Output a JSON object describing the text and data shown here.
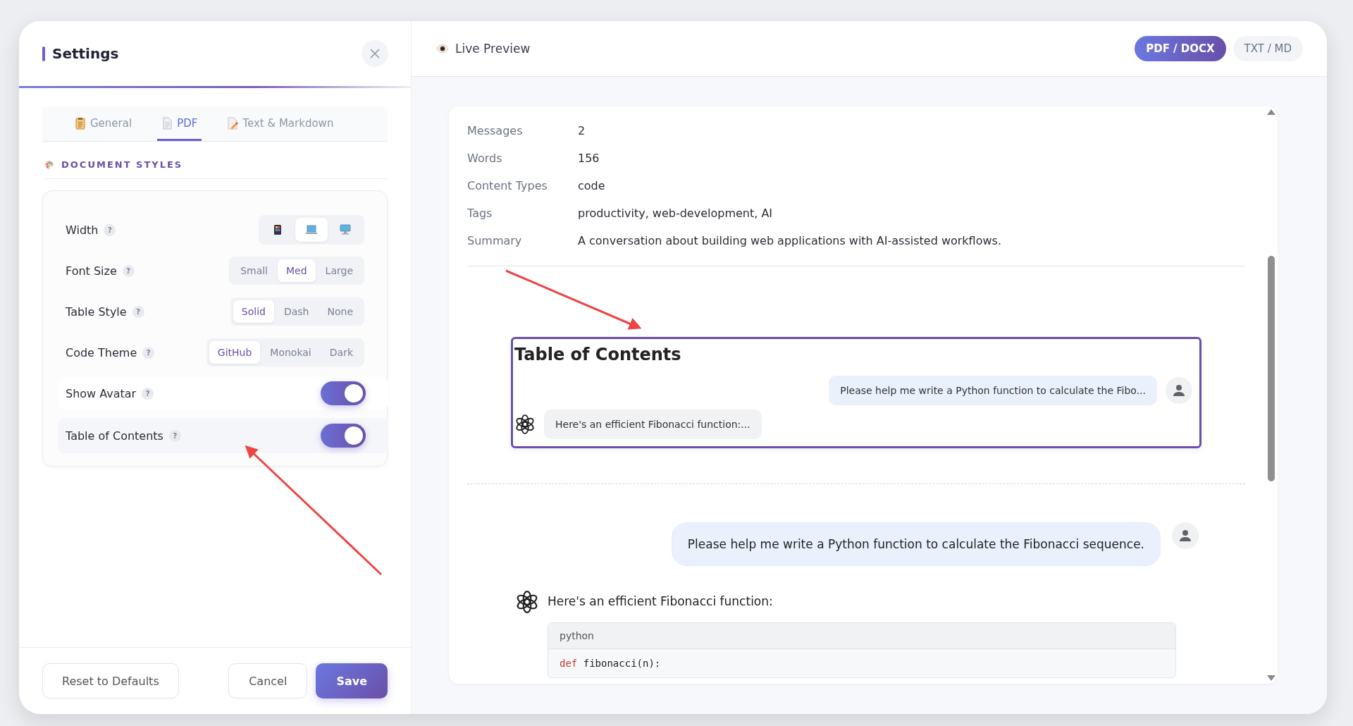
{
  "settings": {
    "title": "Settings",
    "tabs": [
      {
        "label": "General",
        "selected": false
      },
      {
        "label": "PDF",
        "selected": true
      },
      {
        "label": "Text & Markdown",
        "selected": false
      }
    ],
    "section_title": "DOCUMENT STYLES",
    "options": [
      {
        "kind": "icons",
        "label": "Width",
        "help": "?",
        "choices": [
          {
            "selected": false
          },
          {
            "selected": true
          },
          {
            "selected": false
          }
        ]
      },
      {
        "kind": "segmented",
        "label": "Font Size",
        "help": "?",
        "choices": [
          {
            "label": "Small",
            "selected": false
          },
          {
            "label": "Med",
            "selected": true
          },
          {
            "label": "Large",
            "selected": false
          }
        ]
      },
      {
        "kind": "segmented",
        "label": "Table Style",
        "help": "?",
        "choices": [
          {
            "label": "Solid",
            "selected": true
          },
          {
            "label": "Dash",
            "selected": false
          },
          {
            "label": "None",
            "selected": false
          }
        ]
      },
      {
        "kind": "segmented",
        "label": "Code Theme",
        "help": "?",
        "choices": [
          {
            "label": "GitHub",
            "selected": true
          },
          {
            "label": "Monokai",
            "selected": false
          },
          {
            "label": "Dark",
            "selected": false
          }
        ]
      },
      {
        "kind": "toggle",
        "label": "Show Avatar",
        "help": "?",
        "on": true,
        "highlighted": false
      },
      {
        "kind": "toggle",
        "label": "Table of Contents",
        "help": "?",
        "on": true,
        "highlighted": true
      }
    ],
    "buttons": [
      {
        "label": "Reset to Defaults",
        "kind": "secondary"
      },
      {
        "label": "Cancel",
        "kind": "secondary"
      },
      {
        "label": "Save",
        "kind": "primary"
      }
    ]
  },
  "preview": {
    "title": "Live Preview",
    "formats": [
      {
        "label": "PDF / DOCX",
        "selected": true
      },
      {
        "label": "TXT / MD",
        "selected": false
      }
    ],
    "metadata": [
      {
        "key": "Messages",
        "value": "2"
      },
      {
        "key": "Words",
        "value": "156"
      },
      {
        "key": "Content Types",
        "value": "code"
      },
      {
        "key": "Tags",
        "value": "productivity, web-development, AI"
      },
      {
        "key": "Summary",
        "value": "A conversation about building web applications with AI-assisted workflows."
      }
    ],
    "toc": {
      "title": "Table of Contents",
      "entries": [
        {
          "kind": "user",
          "text": "Please help me write a Python function to calculate the Fibo..."
        },
        {
          "kind": "assistant",
          "text": "Here's an efficient Fibonacci function:..."
        }
      ]
    },
    "messages": [
      {
        "kind": "user",
        "text": "Please help me write a Python function to calculate the Fibonacci sequence."
      },
      {
        "kind": "assistant",
        "text": "Here's an efficient Fibonacci function:",
        "code": {
          "language": "python",
          "lines": [
            [
              {
                "kind": "keyword",
                "text": "def"
              },
              {
                "kind": "plain",
                "text": " fibonacci(n):"
              }
            ]
          ]
        }
      }
    ]
  }
}
